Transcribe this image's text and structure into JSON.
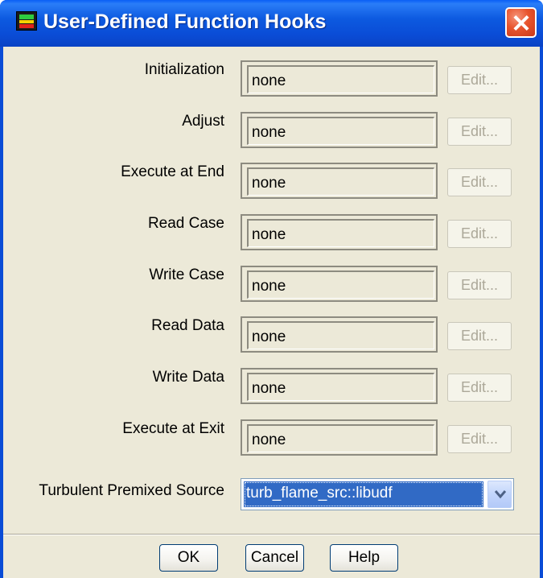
{
  "window": {
    "title": "User-Defined Function Hooks",
    "app_icon": "fluent-app-icon",
    "close_icon": "close-icon"
  },
  "hooks": [
    {
      "label": "Initialization",
      "value": "none",
      "edit_label": "Edit..."
    },
    {
      "label": "Adjust",
      "value": "none",
      "edit_label": "Edit..."
    },
    {
      "label": "Execute at End",
      "value": "none",
      "edit_label": "Edit..."
    },
    {
      "label": "Read Case",
      "value": "none",
      "edit_label": "Edit..."
    },
    {
      "label": "Write Case",
      "value": "none",
      "edit_label": "Edit..."
    },
    {
      "label": "Read Data",
      "value": "none",
      "edit_label": "Edit..."
    },
    {
      "label": "Write Data",
      "value": "none",
      "edit_label": "Edit..."
    },
    {
      "label": "Execute at Exit",
      "value": "none",
      "edit_label": "Edit..."
    }
  ],
  "premixed": {
    "label": "Turbulent Premixed Source",
    "selected": "turb_flame_src::libudf",
    "arrow_icon": "chevron-down-icon"
  },
  "buttons": {
    "ok": "OK",
    "cancel": "Cancel",
    "help": "Help"
  }
}
